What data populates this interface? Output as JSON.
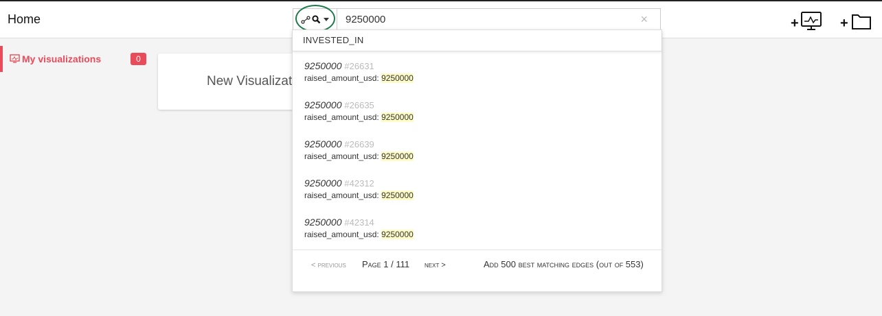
{
  "header": {
    "title": "Home",
    "search_value": "9250000",
    "search_placeholder": "",
    "clear_symbol": "×",
    "search_type_glyph": "⚯ 🔍",
    "add_viz_icon": "add-visualization-icon",
    "add_folder_icon": "add-folder-icon"
  },
  "sidebar": {
    "items": [
      {
        "label": "My visualizations",
        "count": "0",
        "icon": "monitor-icon"
      }
    ]
  },
  "main": {
    "new_viz_label": "New Visualization"
  },
  "dropdown": {
    "header": "INVESTED_IN",
    "results": [
      {
        "title": "9250000",
        "id": "#26631",
        "field": "raised_amount_usd:",
        "value": "9250000"
      },
      {
        "title": "9250000",
        "id": "#26635",
        "field": "raised_amount_usd:",
        "value": "9250000"
      },
      {
        "title": "9250000",
        "id": "#26639",
        "field": "raised_amount_usd:",
        "value": "9250000"
      },
      {
        "title": "9250000",
        "id": "#42312",
        "field": "raised_amount_usd:",
        "value": "9250000"
      },
      {
        "title": "9250000",
        "id": "#42314",
        "field": "raised_amount_usd:",
        "value": "9250000"
      }
    ],
    "footer": {
      "prev": "< previous",
      "page": "Page 1 / 111",
      "next": "next >",
      "add_edges": "Add 500 best matching edges (out of 553)"
    }
  },
  "colors": {
    "accent": "#e84b5a",
    "highlight": "#fdfbc6",
    "ring": "#1e7a4a"
  }
}
